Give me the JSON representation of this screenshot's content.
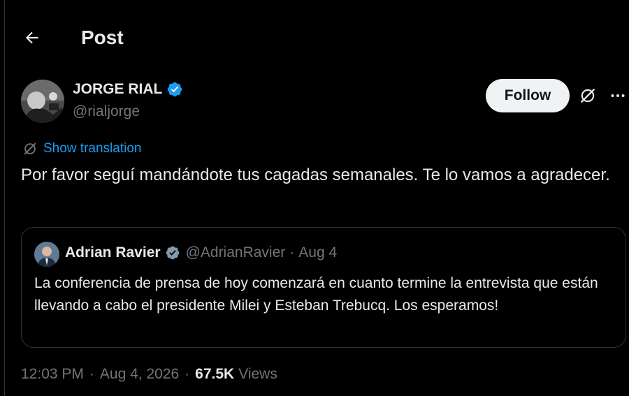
{
  "header": {
    "title": "Post",
    "back_icon": "arrow-left-icon"
  },
  "author": {
    "display_name": "JORGE RIAL",
    "handle": "@rialjorge",
    "verified": true,
    "follow_label": "Follow"
  },
  "translation": {
    "label": "Show translation"
  },
  "post": {
    "text": "Por favor seguí mandándote tus cagadas semanales. Te lo vamos a agradecer."
  },
  "quote": {
    "display_name": "Adrian Ravier",
    "handle": "@AdrianRavier",
    "separator": "·",
    "date": "Aug 4",
    "text": "La conferencia de prensa de hoy comenzará en cuanto termine la entrevista que están llevando a cabo el presidente Milei y Esteban Trebucq. Los esperamos!"
  },
  "meta": {
    "time": "12:03 PM",
    "separator": "·",
    "date": "Aug 4, 2026",
    "views_count": "67.5K",
    "views_label": "Views"
  },
  "colors": {
    "background": "#000000",
    "text": "#e7e9ea",
    "muted": "#71767b",
    "accent": "#1d9bf0",
    "border": "#2f3336",
    "follow_bg": "#eff3f4"
  }
}
